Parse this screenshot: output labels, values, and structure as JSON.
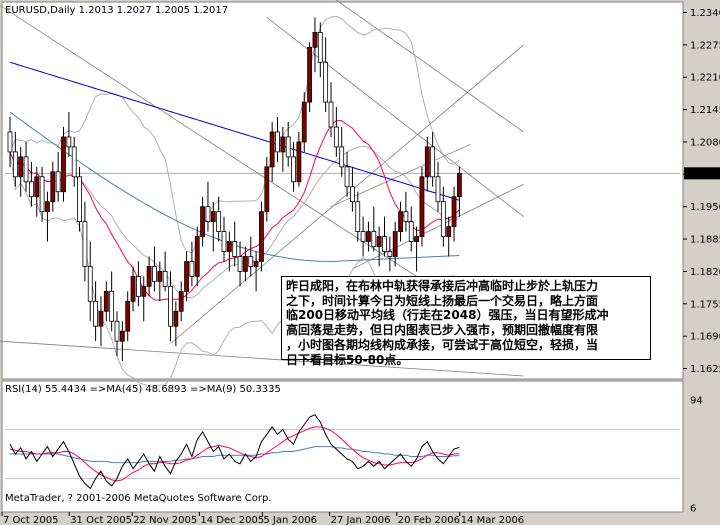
{
  "header": {
    "symbol_info": "EURUSD,Daily  1.2013 1.2027 1.2005 1.2017"
  },
  "indicator_header": {
    "text": "RSI(14) 55.4434  =>MA(45) 48.6893  =>MA(9) 50.3335"
  },
  "copyright": "MetaTrader, ? 2001-2006 MetaQuotes Software Corp.",
  "annotation": {
    "lines": [
      "昨日成阳，在布林中轨获得承接后冲高临时止步於上轨压力",
      "之下，时间计算今日为短线上扬最后一个交易日，略上方面",
      "临200日移动平均线（行走在2048）强压，当日有望形成冲",
      "高回落是走势，但日内图表已步入强市，预期回撤幅度有限",
      "，小时图各期均线构成承接，可尝试于高位短空，轻损，当",
      "日下看目标50-80点。"
    ]
  },
  "colors": {
    "background": "#ffffff",
    "frame": "#d4d0c8",
    "candle_fill": "#800000",
    "candle_wick": "#000000",
    "ma_short": "#ff0066",
    "ma_long_blue": "#0000cc",
    "ma_mid_steelblue": "#4682b4",
    "bollinger": "#b0b0b0",
    "trendline": "#808080",
    "rsi_line": "#000000",
    "rsi_ma_fast": "#ff0066",
    "rsi_ma_slow": "#4682b4"
  },
  "chart_data": {
    "type": "candlestick",
    "price_axis": {
      "ticks": [
        "1.2340",
        "1.2275",
        "1.2210",
        "1.2145",
        "1.2080",
        "1.2015",
        "1.1950",
        "1.1885",
        "1.1820",
        "1.1755",
        "1.1690",
        "1.1625"
      ],
      "current_price": "1.2017",
      "range": [
        1.161,
        1.2355
      ]
    },
    "time_axis": {
      "labels": [
        "7 Oct 2005",
        "31 Oct 2005",
        "22 Nov 2005",
        "14 Dec 2005",
        "5 Jan 2006",
        "27 Jan 2006",
        "20 Feb 2006",
        "14 Mar 2006"
      ]
    },
    "candles_ohlc": [
      [
        1.21,
        1.213,
        1.203,
        1.206
      ],
      [
        1.206,
        1.21,
        1.199,
        1.201
      ],
      [
        1.201,
        1.207,
        1.197,
        1.205
      ],
      [
        1.205,
        1.208,
        1.198,
        1.2
      ],
      [
        1.2,
        1.204,
        1.195,
        1.197
      ],
      [
        1.197,
        1.203,
        1.193,
        1.201
      ],
      [
        1.201,
        1.203,
        1.192,
        1.194
      ],
      [
        1.194,
        1.198,
        1.188,
        1.196
      ],
      [
        1.196,
        1.204,
        1.194,
        1.202
      ],
      [
        1.202,
        1.206,
        1.196,
        1.198
      ],
      [
        1.198,
        1.211,
        1.196,
        1.209
      ],
      [
        1.209,
        1.214,
        1.205,
        1.207
      ],
      [
        1.207,
        1.209,
        1.199,
        1.201
      ],
      [
        1.201,
        1.203,
        1.19,
        1.192
      ],
      [
        1.192,
        1.196,
        1.18,
        1.183
      ],
      [
        1.183,
        1.188,
        1.172,
        1.176
      ],
      [
        1.176,
        1.18,
        1.168,
        1.171
      ],
      [
        1.171,
        1.177,
        1.167,
        1.174
      ],
      [
        1.174,
        1.18,
        1.172,
        1.178
      ],
      [
        1.178,
        1.182,
        1.17,
        1.172
      ],
      [
        1.172,
        1.174,
        1.165,
        1.168
      ],
      [
        1.168,
        1.172,
        1.164,
        1.17
      ],
      [
        1.17,
        1.178,
        1.168,
        1.176
      ],
      [
        1.176,
        1.183,
        1.174,
        1.181
      ],
      [
        1.181,
        1.184,
        1.175,
        1.177
      ],
      [
        1.177,
        1.181,
        1.172,
        1.179
      ],
      [
        1.179,
        1.185,
        1.177,
        1.183
      ],
      [
        1.183,
        1.187,
        1.178,
        1.18
      ],
      [
        1.18,
        1.184,
        1.176,
        1.182
      ],
      [
        1.182,
        1.186,
        1.178,
        1.179
      ],
      [
        1.179,
        1.182,
        1.168,
        1.171
      ],
      [
        1.171,
        1.176,
        1.167,
        1.174
      ],
      [
        1.174,
        1.18,
        1.172,
        1.178
      ],
      [
        1.178,
        1.186,
        1.176,
        1.184
      ],
      [
        1.184,
        1.188,
        1.179,
        1.181
      ],
      [
        1.181,
        1.191,
        1.179,
        1.189
      ],
      [
        1.189,
        1.197,
        1.187,
        1.195
      ],
      [
        1.195,
        1.2,
        1.19,
        1.192
      ],
      [
        1.192,
        1.196,
        1.186,
        1.194
      ],
      [
        1.194,
        1.197,
        1.188,
        1.19
      ],
      [
        1.19,
        1.193,
        1.184,
        1.186
      ],
      [
        1.186,
        1.19,
        1.182,
        1.188
      ],
      [
        1.188,
        1.192,
        1.183,
        1.185
      ],
      [
        1.185,
        1.188,
        1.179,
        1.182
      ],
      [
        1.182,
        1.187,
        1.18,
        1.185
      ],
      [
        1.185,
        1.189,
        1.181,
        1.183
      ],
      [
        1.183,
        1.186,
        1.178,
        1.184
      ],
      [
        1.184,
        1.196,
        1.182,
        1.194
      ],
      [
        1.194,
        1.205,
        1.192,
        1.203
      ],
      [
        1.203,
        1.212,
        1.2,
        1.21
      ],
      [
        1.21,
        1.213,
        1.204,
        1.206
      ],
      [
        1.206,
        1.211,
        1.202,
        1.209
      ],
      [
        1.209,
        1.212,
        1.203,
        1.205
      ],
      [
        1.205,
        1.208,
        1.198,
        1.2
      ],
      [
        1.2,
        1.21,
        1.199,
        1.208
      ],
      [
        1.208,
        1.218,
        1.206,
        1.216
      ],
      [
        1.216,
        1.228,
        1.214,
        1.227
      ],
      [
        1.227,
        1.233,
        1.222,
        1.23
      ],
      [
        1.23,
        1.232,
        1.221,
        1.224
      ],
      [
        1.224,
        1.229,
        1.214,
        1.216
      ],
      [
        1.216,
        1.22,
        1.209,
        1.211
      ],
      [
        1.211,
        1.215,
        1.205,
        1.207
      ],
      [
        1.207,
        1.211,
        1.201,
        1.203
      ],
      [
        1.203,
        1.206,
        1.197,
        1.199
      ],
      [
        1.199,
        1.203,
        1.194,
        1.196
      ],
      [
        1.196,
        1.198,
        1.188,
        1.19
      ],
      [
        1.19,
        1.193,
        1.185,
        1.188
      ],
      [
        1.188,
        1.192,
        1.186,
        1.19
      ],
      [
        1.19,
        1.195,
        1.186,
        1.187
      ],
      [
        1.187,
        1.191,
        1.183,
        1.189
      ],
      [
        1.189,
        1.193,
        1.185,
        1.186
      ],
      [
        1.186,
        1.189,
        1.182,
        1.185
      ],
      [
        1.185,
        1.192,
        1.183,
        1.19
      ],
      [
        1.19,
        1.196,
        1.188,
        1.194
      ],
      [
        1.194,
        1.198,
        1.19,
        1.192
      ],
      [
        1.192,
        1.195,
        1.186,
        1.188
      ],
      [
        1.188,
        1.191,
        1.182,
        1.189
      ],
      [
        1.189,
        1.203,
        1.187,
        1.201
      ],
      [
        1.201,
        1.209,
        1.198,
        1.207
      ],
      [
        1.207,
        1.21,
        1.199,
        1.201
      ],
      [
        1.201,
        1.204,
        1.194,
        1.196
      ],
      [
        1.196,
        1.199,
        1.187,
        1.189
      ],
      [
        1.189,
        1.193,
        1.185,
        1.191
      ],
      [
        1.191,
        1.199,
        1.188,
        1.197
      ],
      [
        1.197,
        1.203,
        1.193,
        1.2017
      ]
    ],
    "rsi_axis": {
      "ticks": [
        "94",
        "6"
      ]
    },
    "rsi_values": [
      58,
      50,
      55,
      46,
      52,
      44,
      50,
      56,
      48,
      54,
      60,
      52,
      42,
      32,
      26,
      22,
      30,
      36,
      28,
      24,
      30,
      40,
      46,
      38,
      44,
      50,
      42,
      36,
      48,
      40,
      34,
      44,
      50,
      58,
      48,
      62,
      68,
      60,
      52,
      56,
      46,
      50,
      44,
      42,
      50,
      44,
      48,
      60,
      66,
      72,
      66,
      70,
      62,
      58,
      68,
      74,
      80,
      82,
      76,
      66,
      58,
      54,
      50,
      46,
      44,
      38,
      40,
      44,
      40,
      44,
      38,
      42,
      46,
      50,
      44,
      40,
      46,
      56,
      60,
      52,
      46,
      42,
      48,
      54,
      55.4434
    ],
    "rsi_ma45": [
      50,
      50,
      50,
      50,
      50,
      50,
      50,
      50,
      50,
      50,
      49,
      48,
      47,
      46,
      45,
      44,
      44,
      44,
      44,
      43,
      43,
      43,
      43,
      43,
      43,
      44,
      44,
      44,
      44,
      44,
      44,
      45,
      45,
      46,
      46,
      47,
      48,
      48,
      48,
      49,
      49,
      49,
      49,
      49,
      49,
      49,
      49,
      50,
      50,
      51,
      51,
      52,
      52,
      52,
      53,
      54,
      55,
      56,
      56,
      56,
      56,
      55,
      55,
      54,
      54,
      53,
      52,
      52,
      51,
      51,
      50,
      50,
      49,
      49,
      49,
      48,
      48,
      48,
      49,
      49,
      48,
      48,
      48,
      48.5,
      48.6893
    ],
    "rsi_ma9": [
      54,
      53,
      52,
      52,
      51,
      50,
      50,
      51,
      51,
      51,
      52,
      52,
      50,
      47,
      43,
      39,
      36,
      33,
      31,
      29,
      28,
      29,
      32,
      35,
      37,
      40,
      42,
      42,
      43,
      43,
      42,
      42,
      43,
      45,
      46,
      49,
      52,
      55,
      56,
      57,
      56,
      55,
      53,
      51,
      49,
      48,
      47,
      48,
      51,
      54,
      57,
      60,
      63,
      65,
      67,
      69,
      71,
      72,
      72,
      71,
      69,
      66,
      62,
      58,
      54,
      50,
      47,
      45,
      43,
      42,
      41,
      41,
      42,
      43,
      43,
      43,
      44,
      46,
      49,
      51,
      51,
      50,
      49,
      50,
      50.3335
    ]
  }
}
